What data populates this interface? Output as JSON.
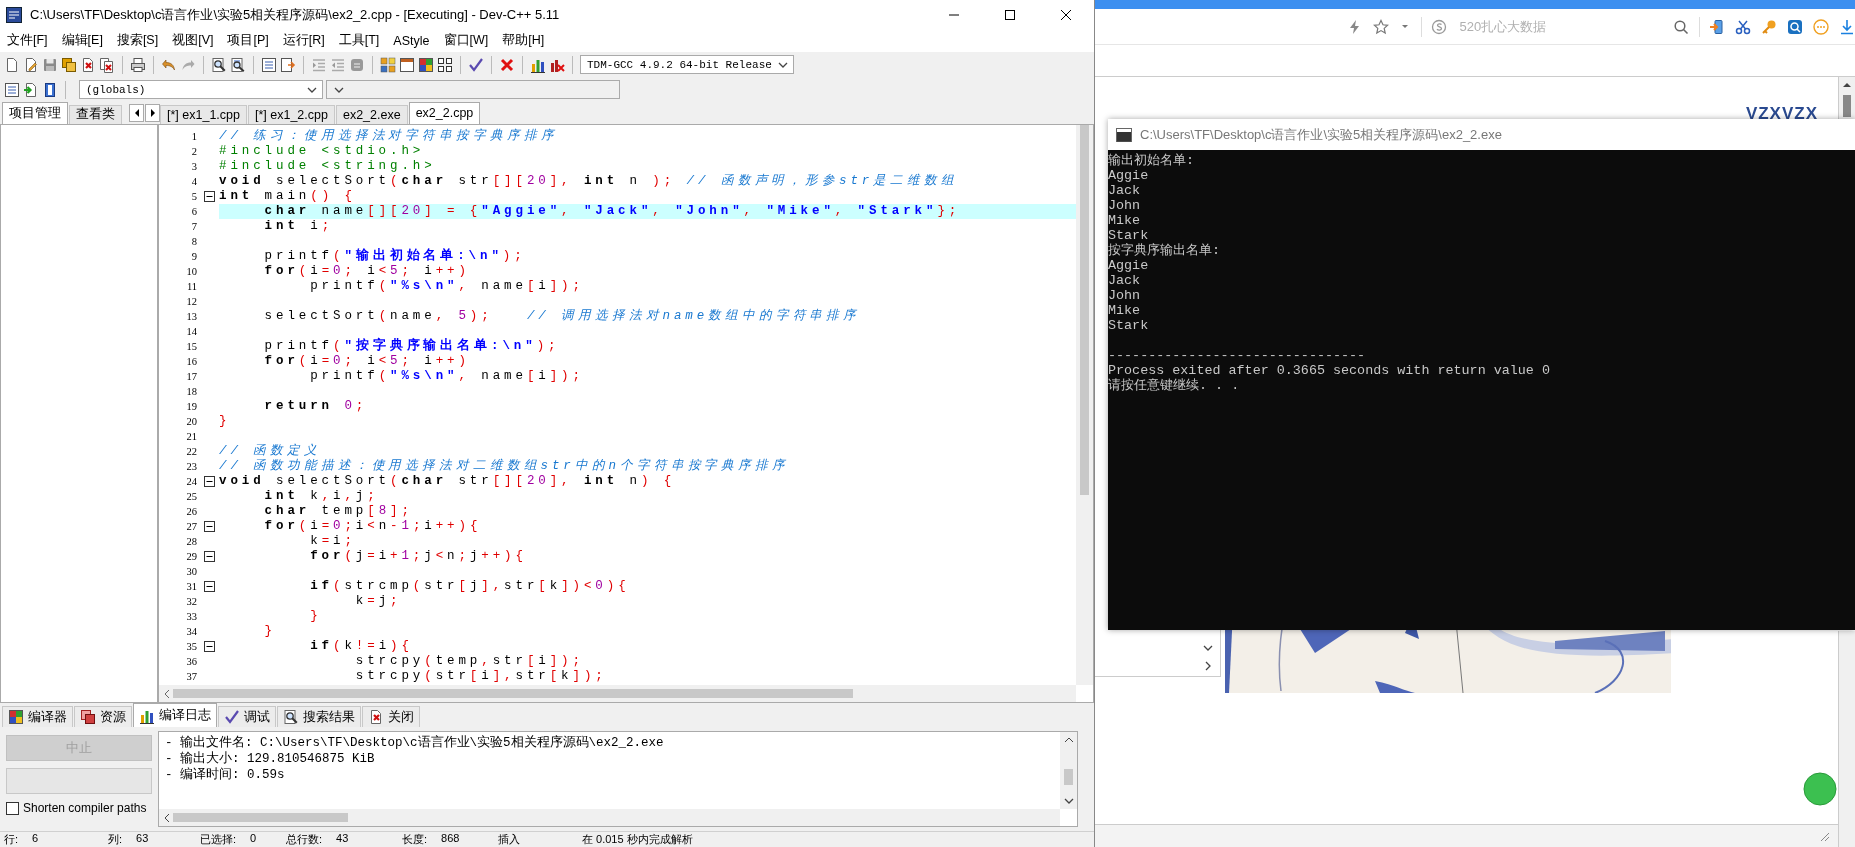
{
  "ide": {
    "title": "C:\\Users\\TF\\Desktop\\c语言作业\\实验5相关程序源码\\ex2_2.cpp - [Executing] - Dev-C++ 5.11",
    "menu": [
      "文件[F]",
      "编辑[E]",
      "搜索[S]",
      "视图[V]",
      "项目[P]",
      "运行[R]",
      "工具[T]",
      "AStyle",
      "窗口[W]",
      "帮助[H]"
    ],
    "compiler_select": {
      "value": "TDM-GCC 4.9.2 64-bit Release"
    },
    "scope_select": {
      "value": "(globals)"
    },
    "side_tabs": [
      {
        "label": "项目管理",
        "selected": true
      },
      {
        "label": "查看类",
        "selected": false
      }
    ],
    "editor_tabs": [
      {
        "label": "[*] ex1_1.cpp",
        "selected": false
      },
      {
        "label": "[*] ex1_2.cpp",
        "selected": false
      },
      {
        "label": "ex2_2.exe",
        "selected": false
      },
      {
        "label": "ex2_2.cpp",
        "selected": true
      }
    ],
    "code_lines": [
      {
        "number": "1",
        "fold": false,
        "current": false,
        "tokens": [
          {
            "kind": "comment",
            "text": "// 练习：使用选择法对字符串按字典序排序"
          }
        ]
      },
      {
        "number": "2",
        "fold": false,
        "current": false,
        "tokens": [
          {
            "kind": "preprocessor",
            "text": "#include <stdio.h>"
          }
        ]
      },
      {
        "number": "3",
        "fold": false,
        "current": false,
        "tokens": [
          {
            "kind": "preprocessor",
            "text": "#include <string.h>"
          }
        ]
      },
      {
        "number": "4",
        "fold": false,
        "current": false,
        "tokens": [
          {
            "kind": "keyword",
            "text": "void"
          },
          {
            "kind": "plain",
            "text": " selectSort"
          },
          {
            "kind": "symbol",
            "text": "("
          },
          {
            "kind": "keyword",
            "text": "char"
          },
          {
            "kind": "plain",
            "text": " str"
          },
          {
            "kind": "symbol",
            "text": "[]["
          },
          {
            "kind": "number",
            "text": "20"
          },
          {
            "kind": "symbol",
            "text": "],"
          },
          {
            "kind": "keyword",
            "text": " int"
          },
          {
            "kind": "plain",
            "text": " n "
          },
          {
            "kind": "symbol",
            "text": ");"
          },
          {
            "kind": "comment",
            "text": " // 函数声明，形参str是二维数组"
          }
        ]
      },
      {
        "number": "5",
        "fold": true,
        "current": false,
        "tokens": [
          {
            "kind": "keyword",
            "text": "int"
          },
          {
            "kind": "plain",
            "text": " main"
          },
          {
            "kind": "symbol",
            "text": "() {"
          }
        ]
      },
      {
        "number": "6",
        "fold": false,
        "current": true,
        "tokens": [
          {
            "kind": "keyword",
            "text": "    char"
          },
          {
            "kind": "plain",
            "text": " name"
          },
          {
            "kind": "symbol",
            "text": "[]["
          },
          {
            "kind": "number",
            "text": "20"
          },
          {
            "kind": "symbol",
            "text": "] = {"
          },
          {
            "kind": "string",
            "text": "\"Aggie\""
          },
          {
            "kind": "symbol",
            "text": ", "
          },
          {
            "kind": "string",
            "text": "\"Jack\""
          },
          {
            "kind": "symbol",
            "text": ", "
          },
          {
            "kind": "string",
            "text": "\"John\""
          },
          {
            "kind": "symbol",
            "text": ", "
          },
          {
            "kind": "string",
            "text": "\"Mike\""
          },
          {
            "kind": "symbol",
            "text": ", "
          },
          {
            "kind": "string",
            "text": "\"Stark\""
          },
          {
            "kind": "symbol",
            "text": "};"
          }
        ]
      },
      {
        "number": "7",
        "fold": false,
        "current": false,
        "tokens": [
          {
            "kind": "keyword",
            "text": "    int"
          },
          {
            "kind": "plain",
            "text": " i"
          },
          {
            "kind": "symbol",
            "text": ";"
          }
        ]
      },
      {
        "number": "8",
        "fold": false,
        "current": false
      },
      {
        "number": "9",
        "fold": false,
        "current": false,
        "tokens": [
          {
            "kind": "plain",
            "text": "    printf"
          },
          {
            "kind": "symbol",
            "text": "("
          },
          {
            "kind": "string",
            "text": "\"输出初始名单:\\n\""
          },
          {
            "kind": "symbol",
            "text": ");"
          }
        ]
      },
      {
        "number": "10",
        "fold": false,
        "current": false,
        "tokens": [
          {
            "kind": "keyword",
            "text": "    for"
          },
          {
            "kind": "symbol",
            "text": "("
          },
          {
            "kind": "plain",
            "text": "i"
          },
          {
            "kind": "symbol",
            "text": "="
          },
          {
            "kind": "number",
            "text": "0"
          },
          {
            "kind": "symbol",
            "text": ";"
          },
          {
            "kind": "plain",
            "text": " i"
          },
          {
            "kind": "symbol",
            "text": "<"
          },
          {
            "kind": "number",
            "text": "5"
          },
          {
            "kind": "symbol",
            "text": ";"
          },
          {
            "kind": "plain",
            "text": " i"
          },
          {
            "kind": "symbol",
            "text": "++)"
          }
        ]
      },
      {
        "number": "11",
        "fold": false,
        "current": false,
        "tokens": [
          {
            "kind": "plain",
            "text": "        printf"
          },
          {
            "kind": "symbol",
            "text": "("
          },
          {
            "kind": "string",
            "text": "\"%s\\n\""
          },
          {
            "kind": "symbol",
            "text": ","
          },
          {
            "kind": "plain",
            "text": " name"
          },
          {
            "kind": "symbol",
            "text": "["
          },
          {
            "kind": "plain",
            "text": "i"
          },
          {
            "kind": "symbol",
            "text": "]);"
          }
        ]
      },
      {
        "number": "12",
        "fold": false,
        "current": false
      },
      {
        "number": "13",
        "fold": false,
        "current": false,
        "tokens": [
          {
            "kind": "plain",
            "text": "    selectSort"
          },
          {
            "kind": "symbol",
            "text": "("
          },
          {
            "kind": "plain",
            "text": "name"
          },
          {
            "kind": "symbol",
            "text": ","
          },
          {
            "kind": "number",
            "text": " 5"
          },
          {
            "kind": "symbol",
            "text": ");"
          },
          {
            "kind": "comment",
            "text": "   // 调用选择法对name数组中的字符串排序"
          }
        ]
      },
      {
        "number": "14",
        "fold": false,
        "current": false
      },
      {
        "number": "15",
        "fold": false,
        "current": false,
        "tokens": [
          {
            "kind": "plain",
            "text": "    printf"
          },
          {
            "kind": "symbol",
            "text": "("
          },
          {
            "kind": "string",
            "text": "\"按字典序输出名单:\\n\""
          },
          {
            "kind": "symbol",
            "text": ");"
          }
        ]
      },
      {
        "number": "16",
        "fold": false,
        "current": false,
        "tokens": [
          {
            "kind": "keyword",
            "text": "    for"
          },
          {
            "kind": "symbol",
            "text": "("
          },
          {
            "kind": "plain",
            "text": "i"
          },
          {
            "kind": "symbol",
            "text": "="
          },
          {
            "kind": "number",
            "text": "0"
          },
          {
            "kind": "symbol",
            "text": ";"
          },
          {
            "kind": "plain",
            "text": " i"
          },
          {
            "kind": "symbol",
            "text": "<"
          },
          {
            "kind": "number",
            "text": "5"
          },
          {
            "kind": "symbol",
            "text": ";"
          },
          {
            "kind": "plain",
            "text": " i"
          },
          {
            "kind": "symbol",
            "text": "++)"
          }
        ]
      },
      {
        "number": "17",
        "fold": false,
        "current": false,
        "tokens": [
          {
            "kind": "plain",
            "text": "        printf"
          },
          {
            "kind": "symbol",
            "text": "("
          },
          {
            "kind": "string",
            "text": "\"%s\\n\""
          },
          {
            "kind": "symbol",
            "text": ","
          },
          {
            "kind": "plain",
            "text": " name"
          },
          {
            "kind": "symbol",
            "text": "["
          },
          {
            "kind": "plain",
            "text": "i"
          },
          {
            "kind": "symbol",
            "text": "]);"
          }
        ]
      },
      {
        "number": "18",
        "fold": false,
        "current": false
      },
      {
        "number": "19",
        "fold": false,
        "current": false,
        "tokens": [
          {
            "kind": "keyword",
            "text": "    return"
          },
          {
            "kind": "number",
            "text": " 0"
          },
          {
            "kind": "symbol",
            "text": ";"
          }
        ]
      },
      {
        "number": "20",
        "fold": false,
        "current": false,
        "tokens": [
          {
            "kind": "symbol",
            "text": "}"
          }
        ]
      },
      {
        "number": "21",
        "fold": false,
        "current": false
      },
      {
        "number": "22",
        "fold": false,
        "current": false,
        "tokens": [
          {
            "kind": "comment",
            "text": "// 函数定义"
          }
        ]
      },
      {
        "number": "23",
        "fold": false,
        "current": false,
        "tokens": [
          {
            "kind": "comment",
            "text": "// 函数功能描述：使用选择法对二维数组str中的n个字符串按字典序排序"
          }
        ]
      },
      {
        "number": "24",
        "fold": true,
        "current": false,
        "tokens": [
          {
            "kind": "keyword",
            "text": "void"
          },
          {
            "kind": "plain",
            "text": " selectSort"
          },
          {
            "kind": "symbol",
            "text": "("
          },
          {
            "kind": "keyword",
            "text": "char"
          },
          {
            "kind": "plain",
            "text": " str"
          },
          {
            "kind": "symbol",
            "text": "[]["
          },
          {
            "kind": "number",
            "text": "20"
          },
          {
            "kind": "symbol",
            "text": "],"
          },
          {
            "kind": "keyword",
            "text": " int"
          },
          {
            "kind": "plain",
            "text": " n"
          },
          {
            "kind": "symbol",
            "text": ") {"
          }
        ]
      },
      {
        "number": "25",
        "fold": false,
        "current": false,
        "tokens": [
          {
            "kind": "keyword",
            "text": "    int"
          },
          {
            "kind": "plain",
            "text": " k"
          },
          {
            "kind": "symbol",
            "text": ","
          },
          {
            "kind": "plain",
            "text": "i"
          },
          {
            "kind": "symbol",
            "text": ","
          },
          {
            "kind": "plain",
            "text": "j"
          },
          {
            "kind": "symbol",
            "text": ";"
          }
        ]
      },
      {
        "number": "26",
        "fold": false,
        "current": false,
        "tokens": [
          {
            "kind": "keyword",
            "text": "    char"
          },
          {
            "kind": "plain",
            "text": " temp"
          },
          {
            "kind": "symbol",
            "text": "["
          },
          {
            "kind": "number",
            "text": "8"
          },
          {
            "kind": "symbol",
            "text": "];"
          }
        ]
      },
      {
        "number": "27",
        "fold": true,
        "current": false,
        "tokens": [
          {
            "kind": "keyword",
            "text": "    for"
          },
          {
            "kind": "symbol",
            "text": "("
          },
          {
            "kind": "plain",
            "text": "i"
          },
          {
            "kind": "symbol",
            "text": "="
          },
          {
            "kind": "number",
            "text": "0"
          },
          {
            "kind": "symbol",
            "text": ";"
          },
          {
            "kind": "plain",
            "text": "i"
          },
          {
            "kind": "symbol",
            "text": "<"
          },
          {
            "kind": "plain",
            "text": "n"
          },
          {
            "kind": "symbol",
            "text": "-"
          },
          {
            "kind": "number",
            "text": "1"
          },
          {
            "kind": "symbol",
            "text": ";"
          },
          {
            "kind": "plain",
            "text": "i"
          },
          {
            "kind": "symbol",
            "text": "++){"
          }
        ]
      },
      {
        "number": "28",
        "fold": false,
        "current": false,
        "tokens": [
          {
            "kind": "plain",
            "text": "        k"
          },
          {
            "kind": "symbol",
            "text": "="
          },
          {
            "kind": "plain",
            "text": "i"
          },
          {
            "kind": "symbol",
            "text": ";"
          }
        ]
      },
      {
        "number": "29",
        "fold": true,
        "current": false,
        "tokens": [
          {
            "kind": "keyword",
            "text": "        for"
          },
          {
            "kind": "symbol",
            "text": "("
          },
          {
            "kind": "plain",
            "text": "j"
          },
          {
            "kind": "symbol",
            "text": "="
          },
          {
            "kind": "plain",
            "text": "i"
          },
          {
            "kind": "symbol",
            "text": "+"
          },
          {
            "kind": "number",
            "text": "1"
          },
          {
            "kind": "symbol",
            "text": ";"
          },
          {
            "kind": "plain",
            "text": "j"
          },
          {
            "kind": "symbol",
            "text": "<"
          },
          {
            "kind": "plain",
            "text": "n"
          },
          {
            "kind": "symbol",
            "text": ";"
          },
          {
            "kind": "plain",
            "text": "j"
          },
          {
            "kind": "symbol",
            "text": "++){"
          }
        ]
      },
      {
        "number": "30",
        "fold": false,
        "current": false
      },
      {
        "number": "31",
        "fold": true,
        "current": false,
        "tokens": [
          {
            "kind": "keyword",
            "text": "        if"
          },
          {
            "kind": "symbol",
            "text": "("
          },
          {
            "kind": "plain",
            "text": "strcmp"
          },
          {
            "kind": "symbol",
            "text": "("
          },
          {
            "kind": "plain",
            "text": "str"
          },
          {
            "kind": "symbol",
            "text": "["
          },
          {
            "kind": "plain",
            "text": "j"
          },
          {
            "kind": "symbol",
            "text": "],"
          },
          {
            "kind": "plain",
            "text": "str"
          },
          {
            "kind": "symbol",
            "text": "["
          },
          {
            "kind": "plain",
            "text": "k"
          },
          {
            "kind": "symbol",
            "text": "])<"
          },
          {
            "kind": "number",
            "text": "0"
          },
          {
            "kind": "symbol",
            "text": "){"
          }
        ]
      },
      {
        "number": "32",
        "fold": false,
        "current": false,
        "tokens": [
          {
            "kind": "plain",
            "text": "            k"
          },
          {
            "kind": "symbol",
            "text": "="
          },
          {
            "kind": "plain",
            "text": "j"
          },
          {
            "kind": "symbol",
            "text": ";"
          }
        ]
      },
      {
        "number": "33",
        "fold": false,
        "current": false,
        "tokens": [
          {
            "kind": "symbol",
            "text": "        }"
          }
        ]
      },
      {
        "number": "34",
        "fold": false,
        "current": false,
        "tokens": [
          {
            "kind": "symbol",
            "text": "    }"
          }
        ]
      },
      {
        "number": "35",
        "fold": true,
        "current": false,
        "tokens": [
          {
            "kind": "keyword",
            "text": "        if"
          },
          {
            "kind": "symbol",
            "text": "("
          },
          {
            "kind": "plain",
            "text": "k"
          },
          {
            "kind": "symbol",
            "text": "!="
          },
          {
            "kind": "plain",
            "text": "i"
          },
          {
            "kind": "symbol",
            "text": "){"
          }
        ]
      },
      {
        "number": "36",
        "fold": false,
        "current": false,
        "tokens": [
          {
            "kind": "plain",
            "text": "            strcpy"
          },
          {
            "kind": "symbol",
            "text": "("
          },
          {
            "kind": "plain",
            "text": "temp"
          },
          {
            "kind": "symbol",
            "text": ","
          },
          {
            "kind": "plain",
            "text": "str"
          },
          {
            "kind": "symbol",
            "text": "["
          },
          {
            "kind": "plain",
            "text": "i"
          },
          {
            "kind": "symbol",
            "text": "]);"
          }
        ]
      },
      {
        "number": "37",
        "fold": false,
        "current": false,
        "tokens": [
          {
            "kind": "plain",
            "text": "            strcpy"
          },
          {
            "kind": "symbol",
            "text": "("
          },
          {
            "kind": "plain",
            "text": "str"
          },
          {
            "kind": "symbol",
            "text": "["
          },
          {
            "kind": "plain",
            "text": "i"
          },
          {
            "kind": "symbol",
            "text": "],"
          },
          {
            "kind": "plain",
            "text": "str"
          },
          {
            "kind": "symbol",
            "text": "["
          },
          {
            "kind": "plain",
            "text": "k"
          },
          {
            "kind": "symbol",
            "text": "]);"
          }
        ]
      }
    ],
    "bottom_tabs": [
      {
        "label": "编译器",
        "selected": false
      },
      {
        "label": "资源",
        "selected": false
      },
      {
        "label": "编译日志",
        "selected": true
      },
      {
        "label": "调试",
        "selected": false
      },
      {
        "label": "搜索结果",
        "selected": false
      },
      {
        "label": "关闭",
        "selected": false
      }
    ],
    "abort_button": {
      "label": "中止",
      "disabled": true
    },
    "shorten_paths": {
      "label": "Shorten compiler paths",
      "checked": false
    },
    "log_lines": [
      "- 输出文件名: C:\\Users\\TF\\Desktop\\c语言作业\\实验5相关程序源码\\ex2_2.exe",
      "- 输出大小: 129.810546875 KiB",
      "- 编译时间: 0.59s"
    ],
    "status_bar": [
      {
        "label": "行:",
        "value": "6"
      },
      {
        "label": "列:",
        "value": "63"
      },
      {
        "label": "已选择:",
        "value": "0"
      },
      {
        "label": "总行数:",
        "value": "43"
      },
      {
        "label": "长度:",
        "value": "868"
      },
      {
        "label": "插入"
      },
      {
        "label": "在 0.015 秒内完成解析"
      }
    ]
  },
  "browser": {
    "search": {
      "placeholder": "520扎心大数据"
    },
    "page_text": "VZXVZX"
  },
  "console": {
    "title": "C:\\Users\\TF\\Desktop\\c语言作业\\实验5相关程序源码\\ex2_2.exe",
    "output_blocks": [
      [
        "输出初始名单:",
        "Aggie",
        "Jack",
        "John",
        "Mike",
        "Stark",
        "按字典序输出名单:",
        "Aggie",
        "Jack",
        "John",
        "Mike",
        "Stark"
      ],
      [
        "--------------------------------",
        "Process exited after 0.3665 seconds with return value 0",
        "请按任意键继续. . ."
      ]
    ]
  }
}
